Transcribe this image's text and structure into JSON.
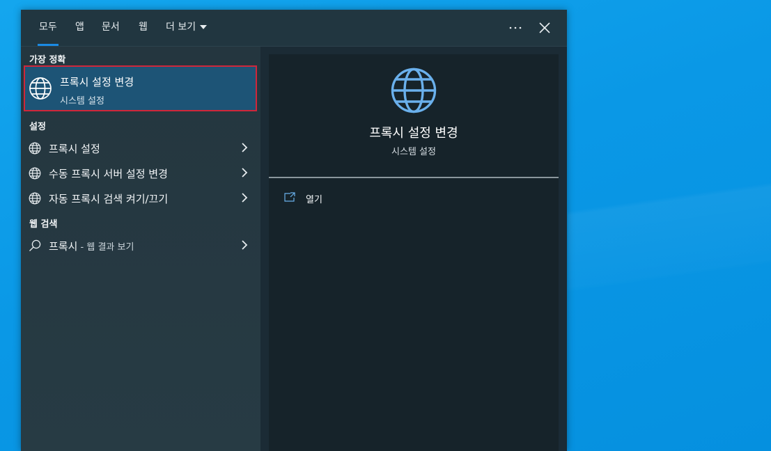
{
  "tabs": [
    {
      "label": "모두",
      "active": true
    },
    {
      "label": "앱"
    },
    {
      "label": "문서"
    },
    {
      "label": "웹"
    },
    {
      "label": "더 보기"
    }
  ],
  "topbar": {
    "more_icon": "ellipsis-icon",
    "close_icon": "close-icon"
  },
  "best_match": {
    "section_label": "가장 정확",
    "title": "프록시 설정 변경",
    "subtitle": "시스템 설정",
    "icon": "globe-icon"
  },
  "settings": {
    "section_label": "설정",
    "items": [
      {
        "label": "프록시 설정",
        "icon": "globe-icon"
      },
      {
        "label": "수동 프록시 서버 설정 변경",
        "icon": "globe-icon"
      },
      {
        "label": "자동 프록시 검색 켜기/끄기",
        "icon": "globe-icon"
      }
    ]
  },
  "web_search": {
    "section_label": "웹 검색",
    "query": "프록시",
    "suffix": " - 웹 결과 보기",
    "icon": "search-icon"
  },
  "preview": {
    "title": "프록시 설정 변경",
    "subtitle": "시스템 설정",
    "actions": [
      {
        "label": "열기",
        "icon": "open-icon"
      }
    ]
  },
  "colors": {
    "accent": "#1a8ae3",
    "selection": "#1d5476",
    "highlight_border": "#d0263a"
  }
}
